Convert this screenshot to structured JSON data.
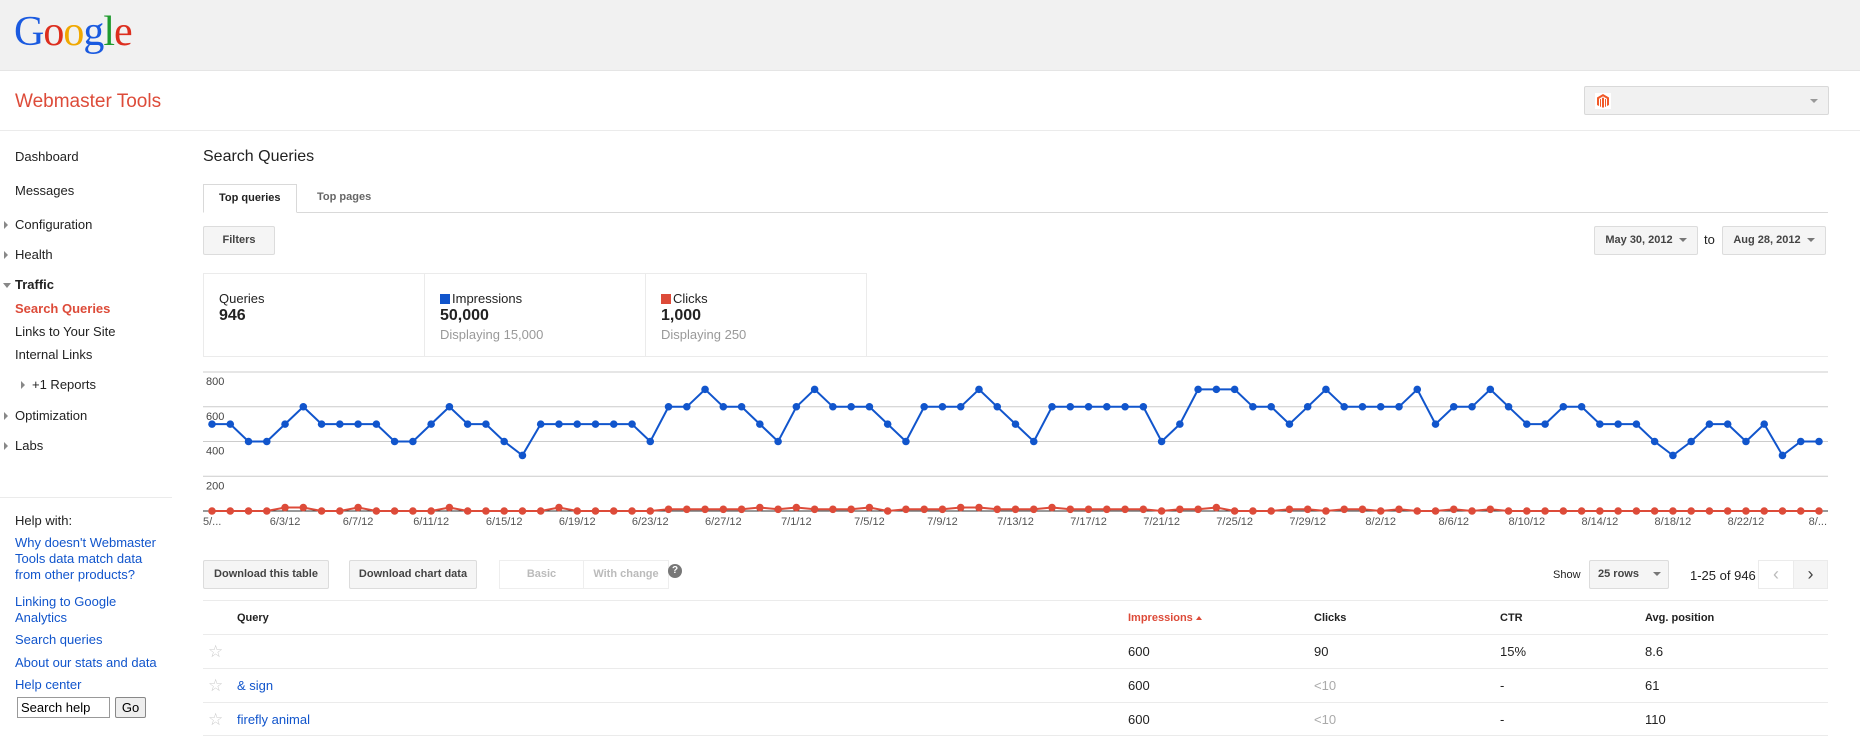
{
  "header": {
    "logo_letters": [
      {
        "ch": "G",
        "cls": "b"
      },
      {
        "ch": "o",
        "cls": "r"
      },
      {
        "ch": "o",
        "cls": "y"
      },
      {
        "ch": "g",
        "cls": "b"
      },
      {
        "ch": "l",
        "cls": "g"
      },
      {
        "ch": "e",
        "cls": "r"
      }
    ],
    "app_title": "Webmaster Tools",
    "site_selector_icon": "magento-logo-icon"
  },
  "sidebar": {
    "items": [
      {
        "label": "Dashboard"
      },
      {
        "label": "Messages"
      },
      {
        "label": "Configuration",
        "expandable": true
      },
      {
        "label": "Health",
        "expandable": true
      },
      {
        "label": "Traffic",
        "expanded": true
      },
      {
        "label": "Search Queries",
        "active": true
      },
      {
        "label": "Links to Your Site"
      },
      {
        "label": "Internal Links"
      },
      {
        "label": "+1 Reports",
        "expandable": true
      },
      {
        "label": "Optimization",
        "expandable": true
      },
      {
        "label": "Labs",
        "expandable": true
      }
    ],
    "help": {
      "title": "Help with:",
      "links": [
        "Why doesn't Webmaster Tools data match data from other products?",
        "Linking to Google Analytics",
        "Search queries",
        "About our stats and data",
        "Help center"
      ],
      "search_placeholder": "Search help",
      "search_value": "Search help",
      "go_label": "Go"
    }
  },
  "main": {
    "title": "Search Queries",
    "tabs": [
      {
        "label": "Top queries",
        "active": true
      },
      {
        "label": "Top pages"
      }
    ],
    "filters_label": "Filters",
    "date_from": "May 30, 2012",
    "date_to_label": "to",
    "date_to": "Aug 28, 2012",
    "summary": {
      "queries": {
        "label": "Queries",
        "value": "946"
      },
      "impressions": {
        "label": "Impressions",
        "value": "50,000",
        "sub": "Displaying 15,000",
        "color": "#1155cc"
      },
      "clicks": {
        "label": "Clicks",
        "value": "1,000",
        "sub": "Displaying 250",
        "color": "#dd4b39"
      }
    },
    "download_table_label": "Download this table",
    "download_chart_label": "Download chart data",
    "view_toggle": {
      "basic": "Basic",
      "with_change": "With change"
    },
    "help_icon": "?",
    "show_label": "Show",
    "rows_select": "25 rows",
    "pager_text": "1-25 of 946",
    "pager_prev": "‹",
    "pager_next": "›",
    "table": {
      "columns": [
        "Query",
        "Impressions",
        "Clicks",
        "CTR",
        "Avg. position"
      ],
      "sorted_column": "Impressions",
      "rows": [
        {
          "query": "",
          "impressions": "600",
          "clicks": "90",
          "ctr": "15%",
          "position": "8.6"
        },
        {
          "query": "& sign",
          "impressions": "600",
          "clicks": "<10",
          "ctr": "-",
          "position": "61"
        },
        {
          "query": "firefly animal",
          "impressions": "600",
          "clicks": "<10",
          "ctr": "-",
          "position": "110"
        }
      ]
    }
  },
  "chart_data": {
    "type": "line",
    "title": "",
    "xlabel": "",
    "ylabel": "",
    "ylim": [
      0,
      800
    ],
    "yticks": [
      200,
      400,
      600,
      800
    ],
    "grid": true,
    "start_date": "2012-05-30",
    "x_tick_labels": [
      "5/...",
      "6/3/12",
      "6/7/12",
      "6/11/12",
      "6/15/12",
      "6/19/12",
      "6/23/12",
      "6/27/12",
      "7/1/12",
      "7/5/12",
      "7/9/12",
      "7/13/12",
      "7/17/12",
      "7/21/12",
      "7/25/12",
      "7/29/12",
      "8/2/12",
      "8/6/12",
      "8/10/12",
      "8/14/12",
      "8/18/12",
      "8/22/12",
      "8/..."
    ],
    "x_tick_every": 4,
    "series": [
      {
        "name": "Impressions",
        "color": "#1155cc",
        "values": [
          500,
          500,
          400,
          400,
          500,
          600,
          500,
          500,
          500,
          500,
          400,
          400,
          500,
          600,
          500,
          500,
          400,
          320,
          500,
          500,
          500,
          500,
          500,
          500,
          400,
          600,
          600,
          700,
          600,
          600,
          500,
          400,
          600,
          700,
          600,
          600,
          600,
          500,
          400,
          600,
          600,
          600,
          700,
          600,
          500,
          400,
          600,
          600,
          600,
          600,
          600,
          600,
          400,
          500,
          700,
          700,
          700,
          600,
          600,
          500,
          600,
          700,
          600,
          600,
          600,
          600,
          700,
          500,
          600,
          600,
          700,
          600,
          500,
          500,
          600,
          600,
          500,
          500,
          500,
          400,
          320,
          400,
          500,
          500,
          400,
          500,
          320,
          400,
          400
        ]
      },
      {
        "name": "Clicks",
        "color": "#dd4b39",
        "values": [
          0,
          0,
          0,
          0,
          20,
          20,
          0,
          0,
          20,
          0,
          0,
          0,
          0,
          20,
          0,
          0,
          0,
          0,
          0,
          20,
          0,
          0,
          0,
          0,
          0,
          10,
          10,
          10,
          10,
          10,
          20,
          10,
          20,
          10,
          10,
          10,
          20,
          0,
          10,
          10,
          10,
          20,
          20,
          10,
          10,
          10,
          20,
          10,
          10,
          10,
          10,
          10,
          0,
          10,
          10,
          20,
          0,
          0,
          0,
          10,
          10,
          0,
          10,
          10,
          0,
          10,
          0,
          0,
          10,
          0,
          10,
          0,
          0,
          0,
          0,
          0,
          0,
          0,
          0,
          0,
          0,
          0,
          0,
          0,
          0,
          0,
          0,
          0,
          0
        ]
      }
    ]
  }
}
